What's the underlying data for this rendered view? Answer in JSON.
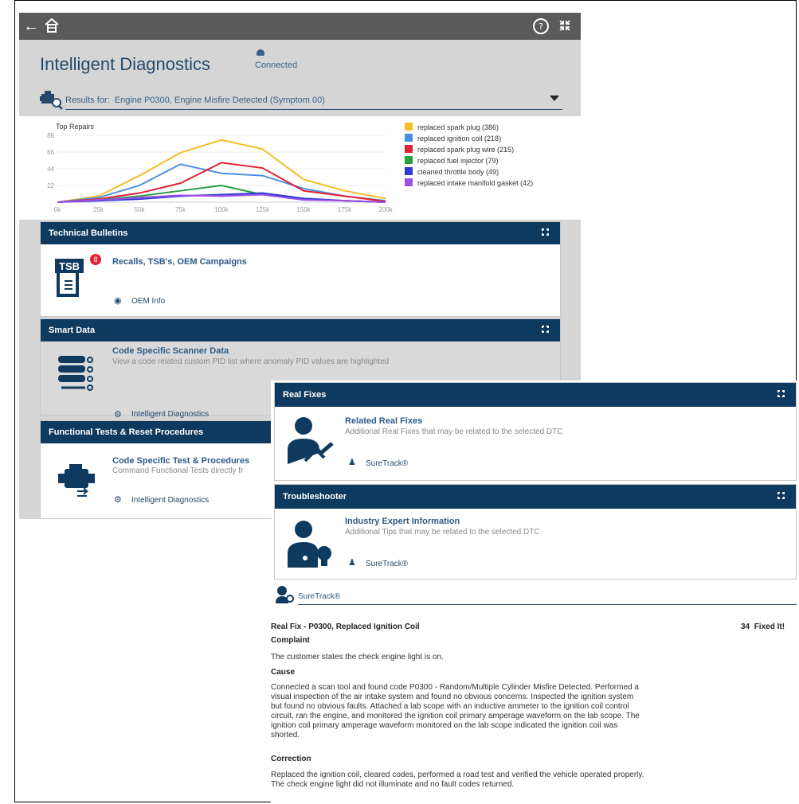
{
  "app": {
    "title": "Intelligent Diagnostics",
    "connection_status": "Connected"
  },
  "results": {
    "label": "Results for:",
    "value": "Engine P0300, Engine Misfire Detected (Symptom 00)"
  },
  "chart_data": {
    "type": "line",
    "title": "Top Repairs",
    "x": [
      "0k",
      "25k",
      "50k",
      "75k",
      "100k",
      "125k",
      "150k",
      "175k",
      "200k"
    ],
    "ylim": [
      0,
      88
    ],
    "yticks": [
      88,
      66,
      44,
      22
    ],
    "series": [
      {
        "name": "replaced spark plug (386)",
        "color": "#f5bd24",
        "values": [
          0,
          8,
          35,
          65,
          82,
          70,
          30,
          15,
          5
        ]
      },
      {
        "name": "replaced ignition coil (218)",
        "color": "#4a8fe0",
        "values": [
          0,
          6,
          22,
          50,
          38,
          35,
          18,
          8,
          2
        ]
      },
      {
        "name": "replaced spark plug wire (215)",
        "color": "#e22232",
        "values": [
          0,
          4,
          12,
          25,
          52,
          45,
          15,
          8,
          1
        ]
      },
      {
        "name": "replaced fuel injector (79)",
        "color": "#27a040",
        "values": [
          0,
          3,
          8,
          15,
          22,
          10,
          4,
          2,
          0
        ]
      },
      {
        "name": "cleaned throttle body (49)",
        "color": "#2f3bd6",
        "values": [
          0,
          2,
          4,
          8,
          10,
          12,
          5,
          2,
          0
        ]
      },
      {
        "name": "replaced intake manifold gasket (42)",
        "color": "#9e4fe8",
        "values": [
          0,
          3,
          6,
          9,
          8,
          10,
          3,
          2,
          0
        ]
      }
    ]
  },
  "technical_bulletins": {
    "header": "Technical Bulletins",
    "tsb_label": "TSB",
    "badge": "8",
    "title": "Recalls, TSB's, OEM Campaigns",
    "link": "OEM Info"
  },
  "smart_data": {
    "header": "Smart Data",
    "title": "Code Specific Scanner Data",
    "desc": "View a code related custom PID list where anomaly PID values are highlighted",
    "link": "Intelligent Diagnostics"
  },
  "functional_tests": {
    "header": "Functional Tests & Reset Procedures",
    "title": "Code Specific Test & Procedures",
    "desc": "Command Functional Tests directly fr",
    "link": "Intelligent Diagnostics"
  },
  "real_fixes": {
    "header": "Real Fixes",
    "title": "Related Real Fixes",
    "desc": "Additional Real Fixes that may be related to the selected DTC",
    "link": "SureTrack®"
  },
  "troubleshooter": {
    "header": "Troubleshooter",
    "title": "Industry Expert Information",
    "desc": "Additional Tips that may be related to the selected DTC",
    "link": "SureTrack®"
  },
  "suretrack": {
    "label": "SureTrack®",
    "fix_title": "Real Fix - P0300, Replaced Ignition Coil",
    "fixed_count": "34",
    "fixed_label": "Fixed It!",
    "complaint_h": "Complaint",
    "complaint": "The customer states the check engine light is on.",
    "cause_h": "Cause",
    "cause": [
      "Connected a scan tool and found code P0300 - Random/Multiple Cylinder Misfire Detected. Performed a",
      "visual inspection of the air intake system and found no obvious concerns. Inspected the ignition system",
      "but found no obvious faults. Attached a lab scope with an inductive ammeter to the ignition coil control",
      "circuit, ran the engine, and monitored the ignition coil primary amperage waveform on the lab scope. The",
      "ignition coil primary amperage waveform monitored on the lab scope indicated the ignition coil was",
      "shorted."
    ],
    "correction_h": "Correction",
    "correction": [
      "Replaced the ignition coil, cleared codes, performed a road test and verified the vehicle operated properly.",
      "The check engine light did not illuminate and no fault codes returned."
    ]
  }
}
